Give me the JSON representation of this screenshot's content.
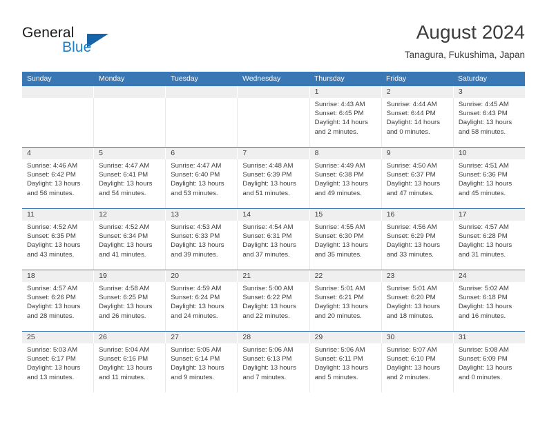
{
  "brand": {
    "name_part1": "General",
    "name_part2": "Blue"
  },
  "header": {
    "title": "August 2024",
    "subtitle": "Tanagura, Fukushima, Japan"
  },
  "theme": {
    "header_blue": "#3a78b5",
    "daynum_band": "#efefef",
    "text": "#3c3c3c",
    "logo_blue": "#1f7fc4",
    "logo_triangle": "#1763a8"
  },
  "weekdays": [
    "Sunday",
    "Monday",
    "Tuesday",
    "Wednesday",
    "Thursday",
    "Friday",
    "Saturday"
  ],
  "weeks": [
    {
      "days": [
        {
          "num": "",
          "sunrise": "",
          "sunset": "",
          "daylight1": "",
          "daylight2": "",
          "empty": true
        },
        {
          "num": "",
          "sunrise": "",
          "sunset": "",
          "daylight1": "",
          "daylight2": "",
          "empty": true
        },
        {
          "num": "",
          "sunrise": "",
          "sunset": "",
          "daylight1": "",
          "daylight2": "",
          "empty": true
        },
        {
          "num": "",
          "sunrise": "",
          "sunset": "",
          "daylight1": "",
          "daylight2": "",
          "empty": true
        },
        {
          "num": "1",
          "sunrise": "Sunrise: 4:43 AM",
          "sunset": "Sunset: 6:45 PM",
          "daylight1": "Daylight: 14 hours",
          "daylight2": "and 2 minutes.",
          "empty": false
        },
        {
          "num": "2",
          "sunrise": "Sunrise: 4:44 AM",
          "sunset": "Sunset: 6:44 PM",
          "daylight1": "Daylight: 14 hours",
          "daylight2": "and 0 minutes.",
          "empty": false
        },
        {
          "num": "3",
          "sunrise": "Sunrise: 4:45 AM",
          "sunset": "Sunset: 6:43 PM",
          "daylight1": "Daylight: 13 hours",
          "daylight2": "and 58 minutes.",
          "empty": false
        }
      ]
    },
    {
      "days": [
        {
          "num": "4",
          "sunrise": "Sunrise: 4:46 AM",
          "sunset": "Sunset: 6:42 PM",
          "daylight1": "Daylight: 13 hours",
          "daylight2": "and 56 minutes.",
          "empty": false
        },
        {
          "num": "5",
          "sunrise": "Sunrise: 4:47 AM",
          "sunset": "Sunset: 6:41 PM",
          "daylight1": "Daylight: 13 hours",
          "daylight2": "and 54 minutes.",
          "empty": false
        },
        {
          "num": "6",
          "sunrise": "Sunrise: 4:47 AM",
          "sunset": "Sunset: 6:40 PM",
          "daylight1": "Daylight: 13 hours",
          "daylight2": "and 53 minutes.",
          "empty": false
        },
        {
          "num": "7",
          "sunrise": "Sunrise: 4:48 AM",
          "sunset": "Sunset: 6:39 PM",
          "daylight1": "Daylight: 13 hours",
          "daylight2": "and 51 minutes.",
          "empty": false
        },
        {
          "num": "8",
          "sunrise": "Sunrise: 4:49 AM",
          "sunset": "Sunset: 6:38 PM",
          "daylight1": "Daylight: 13 hours",
          "daylight2": "and 49 minutes.",
          "empty": false
        },
        {
          "num": "9",
          "sunrise": "Sunrise: 4:50 AM",
          "sunset": "Sunset: 6:37 PM",
          "daylight1": "Daylight: 13 hours",
          "daylight2": "and 47 minutes.",
          "empty": false
        },
        {
          "num": "10",
          "sunrise": "Sunrise: 4:51 AM",
          "sunset": "Sunset: 6:36 PM",
          "daylight1": "Daylight: 13 hours",
          "daylight2": "and 45 minutes.",
          "empty": false
        }
      ]
    },
    {
      "days": [
        {
          "num": "11",
          "sunrise": "Sunrise: 4:52 AM",
          "sunset": "Sunset: 6:35 PM",
          "daylight1": "Daylight: 13 hours",
          "daylight2": "and 43 minutes.",
          "empty": false
        },
        {
          "num": "12",
          "sunrise": "Sunrise: 4:52 AM",
          "sunset": "Sunset: 6:34 PM",
          "daylight1": "Daylight: 13 hours",
          "daylight2": "and 41 minutes.",
          "empty": false
        },
        {
          "num": "13",
          "sunrise": "Sunrise: 4:53 AM",
          "sunset": "Sunset: 6:33 PM",
          "daylight1": "Daylight: 13 hours",
          "daylight2": "and 39 minutes.",
          "empty": false
        },
        {
          "num": "14",
          "sunrise": "Sunrise: 4:54 AM",
          "sunset": "Sunset: 6:31 PM",
          "daylight1": "Daylight: 13 hours",
          "daylight2": "and 37 minutes.",
          "empty": false
        },
        {
          "num": "15",
          "sunrise": "Sunrise: 4:55 AM",
          "sunset": "Sunset: 6:30 PM",
          "daylight1": "Daylight: 13 hours",
          "daylight2": "and 35 minutes.",
          "empty": false
        },
        {
          "num": "16",
          "sunrise": "Sunrise: 4:56 AM",
          "sunset": "Sunset: 6:29 PM",
          "daylight1": "Daylight: 13 hours",
          "daylight2": "and 33 minutes.",
          "empty": false
        },
        {
          "num": "17",
          "sunrise": "Sunrise: 4:57 AM",
          "sunset": "Sunset: 6:28 PM",
          "daylight1": "Daylight: 13 hours",
          "daylight2": "and 31 minutes.",
          "empty": false
        }
      ]
    },
    {
      "days": [
        {
          "num": "18",
          "sunrise": "Sunrise: 4:57 AM",
          "sunset": "Sunset: 6:26 PM",
          "daylight1": "Daylight: 13 hours",
          "daylight2": "and 28 minutes.",
          "empty": false
        },
        {
          "num": "19",
          "sunrise": "Sunrise: 4:58 AM",
          "sunset": "Sunset: 6:25 PM",
          "daylight1": "Daylight: 13 hours",
          "daylight2": "and 26 minutes.",
          "empty": false
        },
        {
          "num": "20",
          "sunrise": "Sunrise: 4:59 AM",
          "sunset": "Sunset: 6:24 PM",
          "daylight1": "Daylight: 13 hours",
          "daylight2": "and 24 minutes.",
          "empty": false
        },
        {
          "num": "21",
          "sunrise": "Sunrise: 5:00 AM",
          "sunset": "Sunset: 6:22 PM",
          "daylight1": "Daylight: 13 hours",
          "daylight2": "and 22 minutes.",
          "empty": false
        },
        {
          "num": "22",
          "sunrise": "Sunrise: 5:01 AM",
          "sunset": "Sunset: 6:21 PM",
          "daylight1": "Daylight: 13 hours",
          "daylight2": "and 20 minutes.",
          "empty": false
        },
        {
          "num": "23",
          "sunrise": "Sunrise: 5:01 AM",
          "sunset": "Sunset: 6:20 PM",
          "daylight1": "Daylight: 13 hours",
          "daylight2": "and 18 minutes.",
          "empty": false
        },
        {
          "num": "24",
          "sunrise": "Sunrise: 5:02 AM",
          "sunset": "Sunset: 6:18 PM",
          "daylight1": "Daylight: 13 hours",
          "daylight2": "and 16 minutes.",
          "empty": false
        }
      ]
    },
    {
      "days": [
        {
          "num": "25",
          "sunrise": "Sunrise: 5:03 AM",
          "sunset": "Sunset: 6:17 PM",
          "daylight1": "Daylight: 13 hours",
          "daylight2": "and 13 minutes.",
          "empty": false
        },
        {
          "num": "26",
          "sunrise": "Sunrise: 5:04 AM",
          "sunset": "Sunset: 6:16 PM",
          "daylight1": "Daylight: 13 hours",
          "daylight2": "and 11 minutes.",
          "empty": false
        },
        {
          "num": "27",
          "sunrise": "Sunrise: 5:05 AM",
          "sunset": "Sunset: 6:14 PM",
          "daylight1": "Daylight: 13 hours",
          "daylight2": "and 9 minutes.",
          "empty": false
        },
        {
          "num": "28",
          "sunrise": "Sunrise: 5:06 AM",
          "sunset": "Sunset: 6:13 PM",
          "daylight1": "Daylight: 13 hours",
          "daylight2": "and 7 minutes.",
          "empty": false
        },
        {
          "num": "29",
          "sunrise": "Sunrise: 5:06 AM",
          "sunset": "Sunset: 6:11 PM",
          "daylight1": "Daylight: 13 hours",
          "daylight2": "and 5 minutes.",
          "empty": false
        },
        {
          "num": "30",
          "sunrise": "Sunrise: 5:07 AM",
          "sunset": "Sunset: 6:10 PM",
          "daylight1": "Daylight: 13 hours",
          "daylight2": "and 2 minutes.",
          "empty": false
        },
        {
          "num": "31",
          "sunrise": "Sunrise: 5:08 AM",
          "sunset": "Sunset: 6:09 PM",
          "daylight1": "Daylight: 13 hours",
          "daylight2": "and 0 minutes.",
          "empty": false
        }
      ]
    }
  ]
}
